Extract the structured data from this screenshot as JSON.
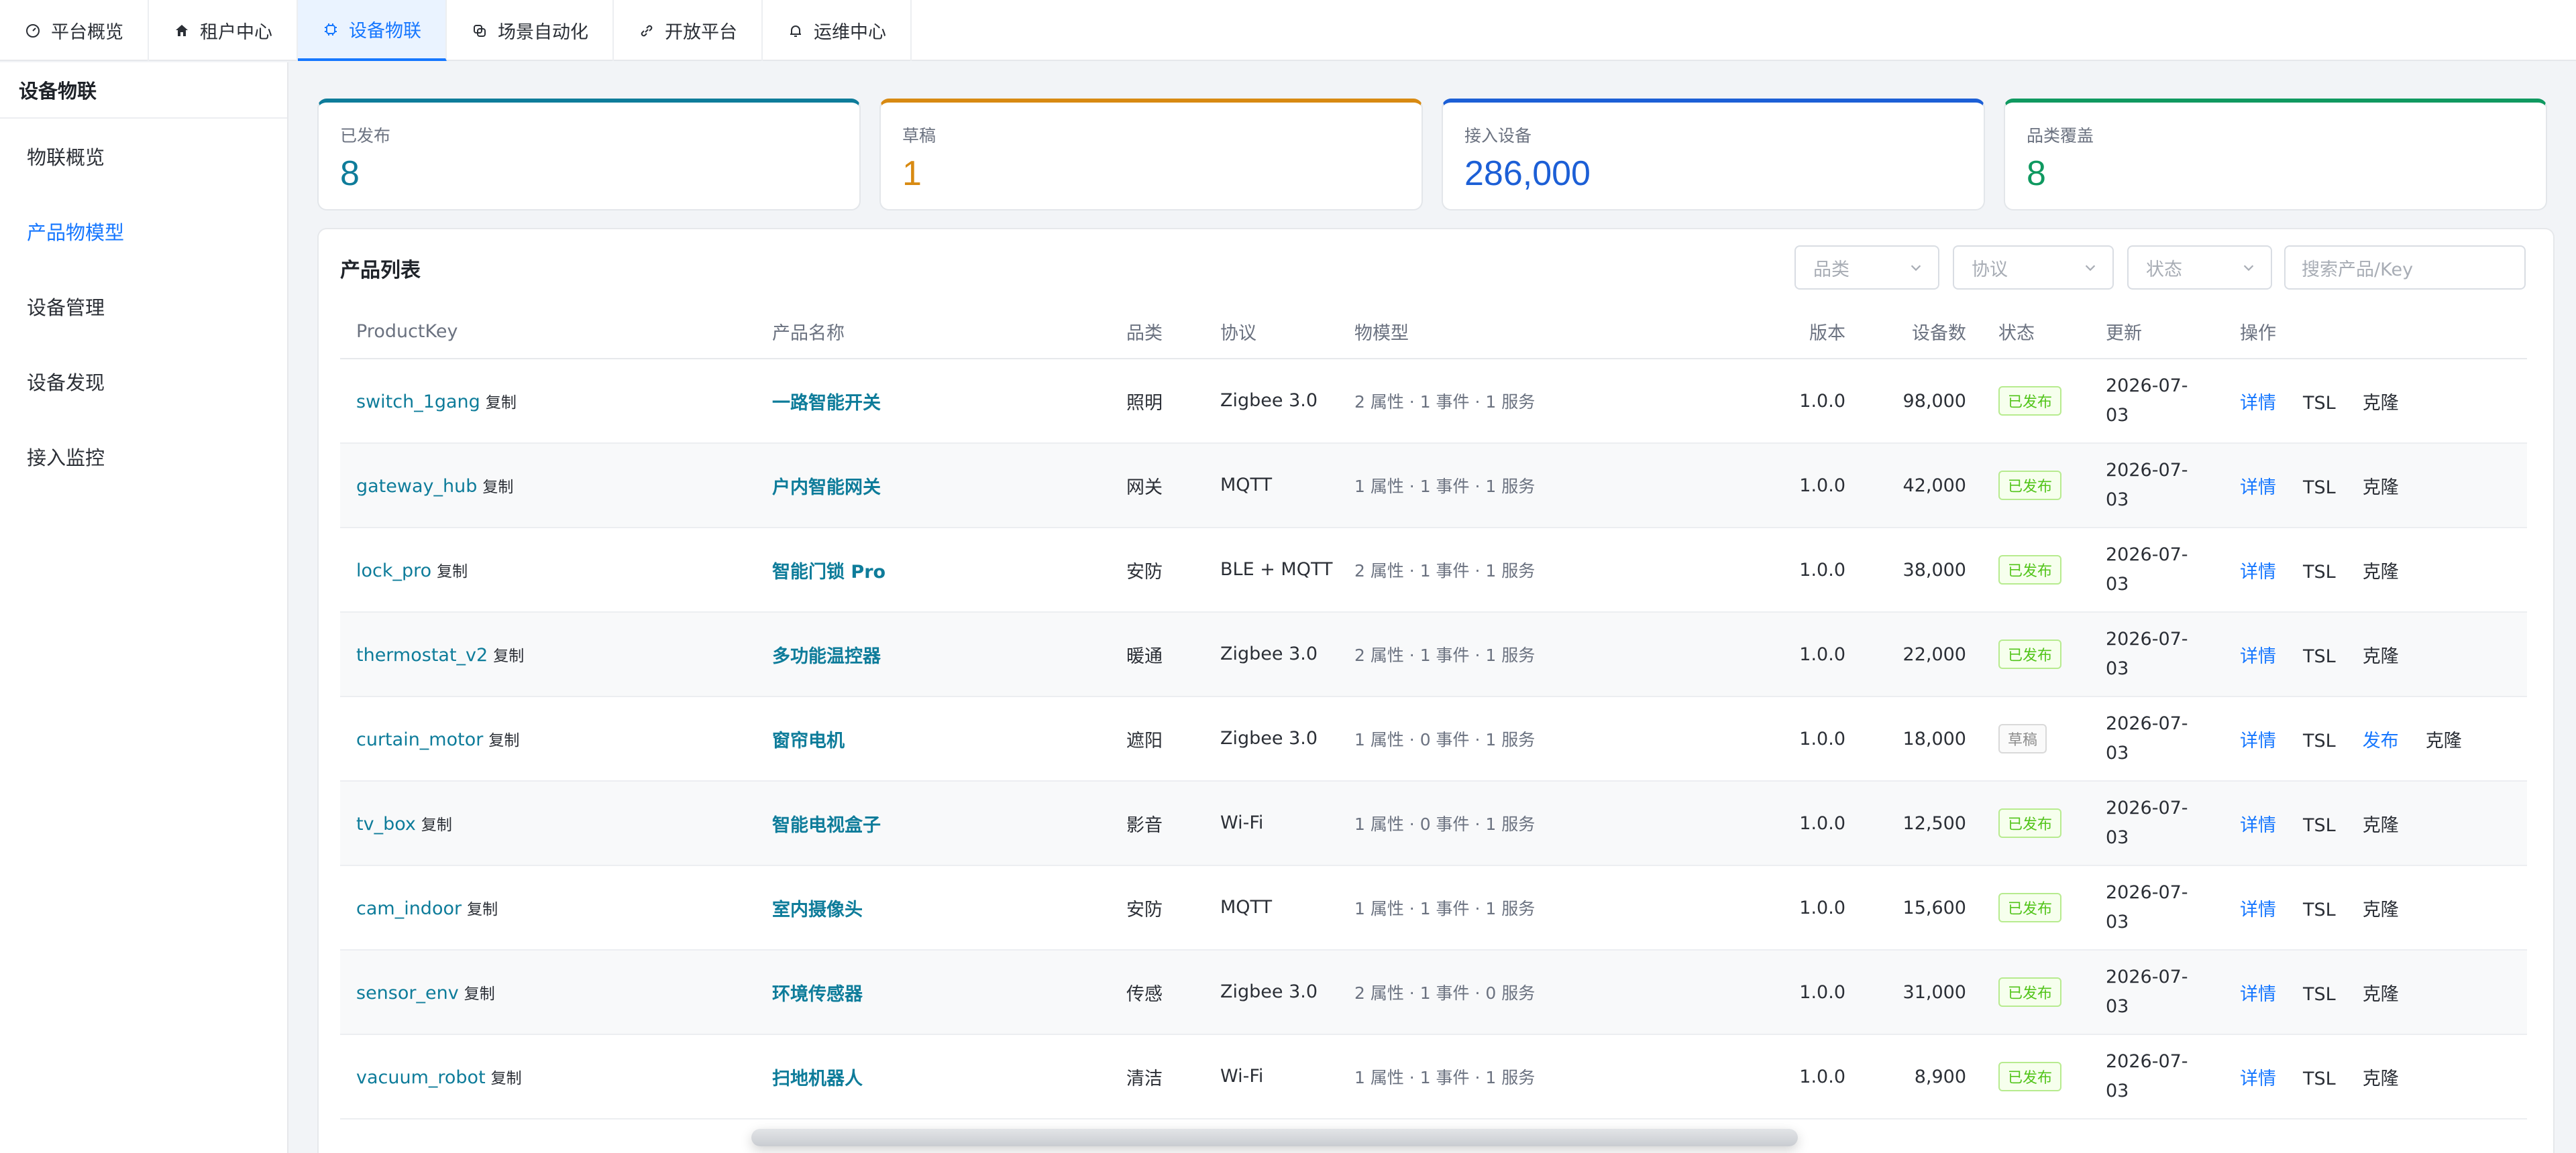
{
  "topnav": {
    "tabs": [
      {
        "label": "平台概览",
        "icon": "dashboard-icon",
        "active": false
      },
      {
        "label": "租户中心",
        "icon": "home-icon",
        "active": false
      },
      {
        "label": "设备物联",
        "icon": "chip-icon",
        "active": true
      },
      {
        "label": "场景自动化",
        "icon": "layers-icon",
        "active": false
      },
      {
        "label": "开放平台",
        "icon": "link-icon",
        "active": false
      },
      {
        "label": "运维中心",
        "icon": "bell-icon",
        "active": false
      }
    ]
  },
  "sidebar": {
    "title": "设备物联",
    "items": [
      {
        "label": "物联概览",
        "active": false
      },
      {
        "label": "产品物模型",
        "active": true
      },
      {
        "label": "设备管理",
        "active": false
      },
      {
        "label": "设备发现",
        "active": false
      },
      {
        "label": "接入监控",
        "active": false
      }
    ]
  },
  "stats": [
    {
      "label": "已发布",
      "value": "8",
      "color": "#0e7c9a"
    },
    {
      "label": "草稿",
      "value": "1",
      "color": "#d88a12"
    },
    {
      "label": "接入设备",
      "value": "286,000",
      "color": "#1c5fd6"
    },
    {
      "label": "品类覆盖",
      "value": "8",
      "color": "#0f9960"
    }
  ],
  "panel": {
    "title": "产品列表",
    "filters": {
      "category": "品类",
      "protocol": "协议",
      "status": "状态"
    },
    "search_placeholder": "搜索产品/Key",
    "columns": [
      "ProductKey",
      "产品名称",
      "品类",
      "协议",
      "物模型",
      "版本",
      "设备数",
      "状态",
      "更新",
      "操作"
    ],
    "copy_label": "复制",
    "rows": [
      {
        "key": "switch_1gang",
        "name": "一路智能开关",
        "category": "照明",
        "protocol": "Zigbee 3.0",
        "tsl": "2 属性 · 1 事件 · 1 服务",
        "version": "1.0.0",
        "devices": "98,000",
        "status": "已发布",
        "draft": false,
        "updated": "2026-07-03",
        "actions": [
          "详情",
          "TSL",
          "克隆"
        ]
      },
      {
        "key": "gateway_hub",
        "name": "户内智能网关",
        "category": "网关",
        "protocol": "MQTT",
        "tsl": "1 属性 · 1 事件 · 1 服务",
        "version": "1.0.0",
        "devices": "42,000",
        "status": "已发布",
        "draft": false,
        "updated": "2026-07-03",
        "actions": [
          "详情",
          "TSL",
          "克隆"
        ]
      },
      {
        "key": "lock_pro",
        "name": "智能门锁 Pro",
        "category": "安防",
        "protocol": "BLE + MQTT",
        "tsl": "2 属性 · 1 事件 · 1 服务",
        "version": "1.0.0",
        "devices": "38,000",
        "status": "已发布",
        "draft": false,
        "updated": "2026-07-03",
        "actions": [
          "详情",
          "TSL",
          "克隆"
        ]
      },
      {
        "key": "thermostat_v2",
        "name": "多功能温控器",
        "category": "暖通",
        "protocol": "Zigbee 3.0",
        "tsl": "2 属性 · 1 事件 · 1 服务",
        "version": "1.0.0",
        "devices": "22,000",
        "status": "已发布",
        "draft": false,
        "updated": "2026-07-03",
        "actions": [
          "详情",
          "TSL",
          "克隆"
        ]
      },
      {
        "key": "curtain_motor",
        "name": "窗帘电机",
        "category": "遮阳",
        "protocol": "Zigbee 3.0",
        "tsl": "1 属性 · 0 事件 · 1 服务",
        "version": "1.0.0",
        "devices": "18,000",
        "status": "草稿",
        "draft": true,
        "updated": "2026-07-03",
        "actions": [
          "详情",
          "TSL",
          "发布",
          "克隆"
        ]
      },
      {
        "key": "tv_box",
        "name": "智能电视盒子",
        "category": "影音",
        "protocol": "Wi-Fi",
        "tsl": "1 属性 · 0 事件 · 1 服务",
        "version": "1.0.0",
        "devices": "12,500",
        "status": "已发布",
        "draft": false,
        "updated": "2026-07-03",
        "actions": [
          "详情",
          "TSL",
          "克隆"
        ]
      },
      {
        "key": "cam_indoor",
        "name": "室内摄像头",
        "category": "安防",
        "protocol": "MQTT",
        "tsl": "1 属性 · 1 事件 · 1 服务",
        "version": "1.0.0",
        "devices": "15,600",
        "status": "已发布",
        "draft": false,
        "updated": "2026-07-03",
        "actions": [
          "详情",
          "TSL",
          "克隆"
        ]
      },
      {
        "key": "sensor_env",
        "name": "环境传感器",
        "category": "传感",
        "protocol": "Zigbee 3.0",
        "tsl": "2 属性 · 1 事件 · 0 服务",
        "version": "1.0.0",
        "devices": "31,000",
        "status": "已发布",
        "draft": false,
        "updated": "2026-07-03",
        "actions": [
          "详情",
          "TSL",
          "克隆"
        ]
      },
      {
        "key": "vacuum_robot",
        "name": "扫地机器人",
        "category": "清洁",
        "protocol": "Wi-Fi",
        "tsl": "1 属性 · 1 事件 · 1 服务",
        "version": "1.0.0",
        "devices": "8,900",
        "status": "已发布",
        "draft": false,
        "updated": "2026-07-03",
        "actions": [
          "详情",
          "TSL",
          "克隆"
        ]
      }
    ]
  }
}
